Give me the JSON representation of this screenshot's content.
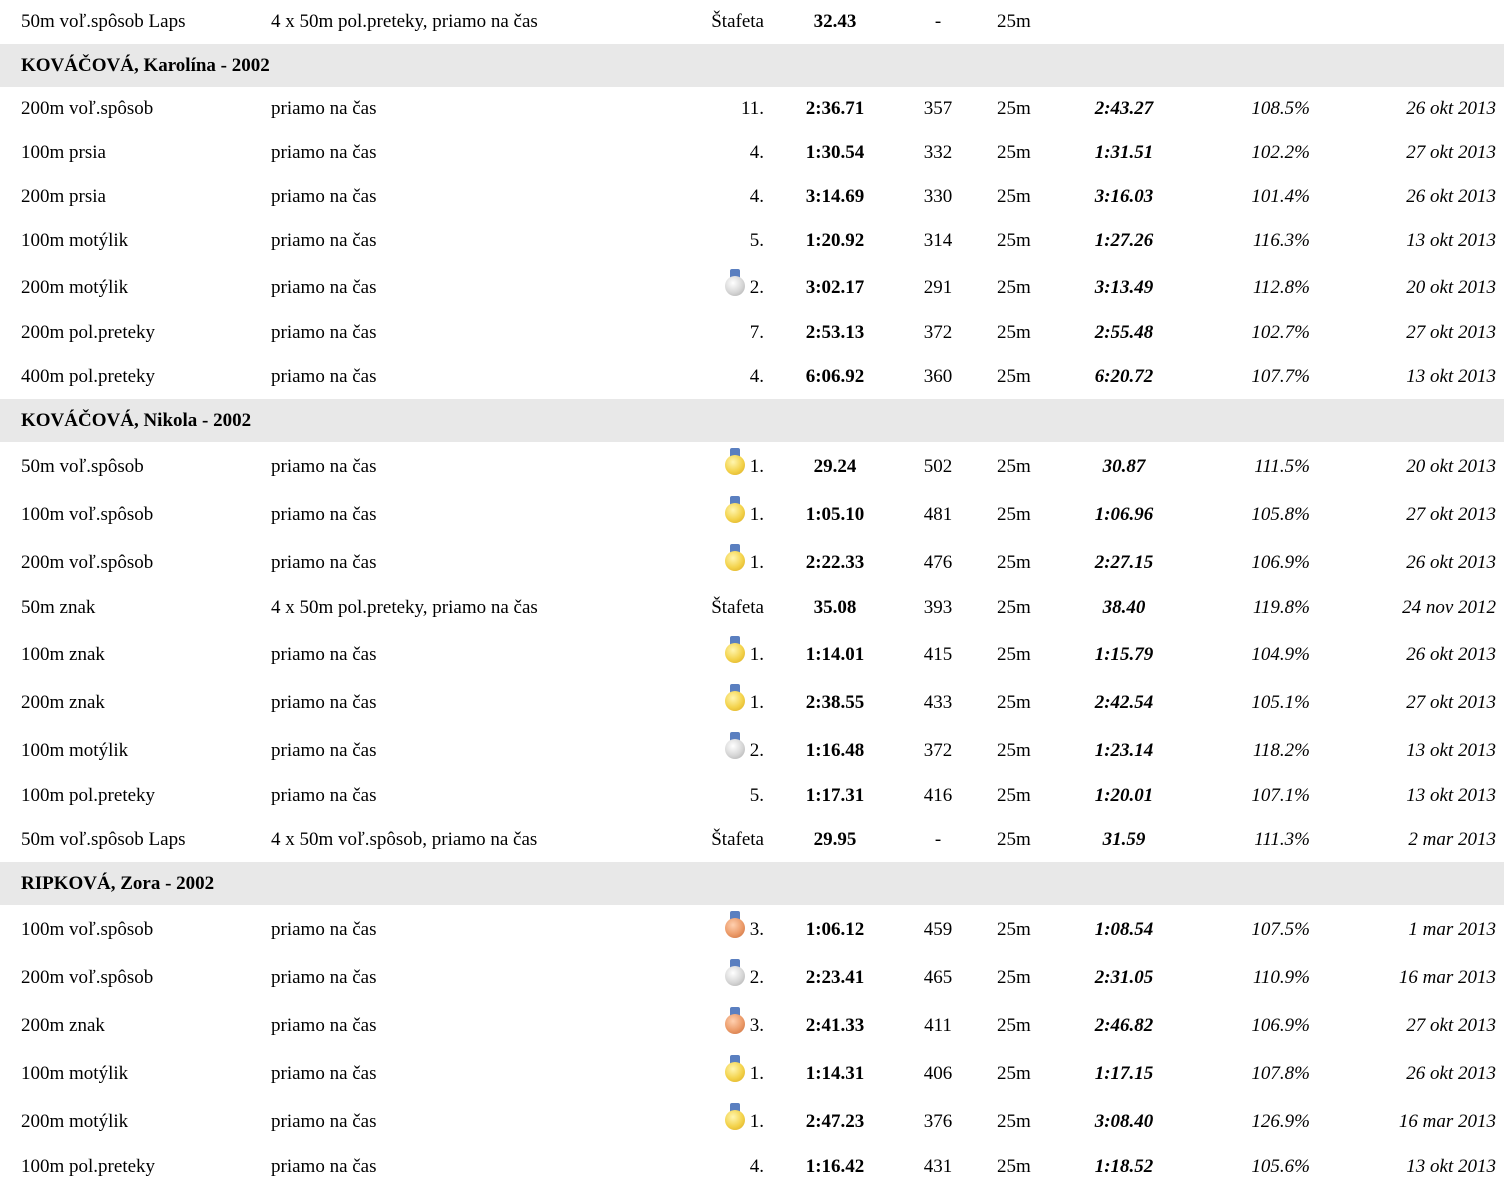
{
  "colors": {
    "header_background": "#e8e8e8",
    "gold": "#f3d24a",
    "silver": "#d6d6d6",
    "bronze": "#eb9a68",
    "ribbon": "#5a7fc0"
  },
  "rows": [
    {
      "type": "result",
      "event": "50m voľ.spôsob Laps",
      "detail": "4 x 50m pol.preteky, priamo na čas",
      "place": "Štafeta",
      "medal": "",
      "time": "32.43",
      "points": "-",
      "pool": "25m",
      "ref_time": "",
      "percent": "",
      "date": ""
    },
    {
      "type": "header",
      "text": "KOVÁČOVÁ, Karolína - 2002"
    },
    {
      "type": "result",
      "event": "200m voľ.spôsob",
      "detail": "priamo na čas",
      "place": "11.",
      "medal": "",
      "time": "2:36.71",
      "points": "357",
      "pool": "25m",
      "ref_time": "2:43.27",
      "percent": "108.5%",
      "date": "26 okt 2013"
    },
    {
      "type": "result",
      "event": "100m prsia",
      "detail": "priamo na čas",
      "place": "4.",
      "medal": "",
      "time": "1:30.54",
      "points": "332",
      "pool": "25m",
      "ref_time": "1:31.51",
      "percent": "102.2%",
      "date": "27 okt 2013"
    },
    {
      "type": "result",
      "event": "200m prsia",
      "detail": "priamo na čas",
      "place": "4.",
      "medal": "",
      "time": "3:14.69",
      "points": "330",
      "pool": "25m",
      "ref_time": "3:16.03",
      "percent": "101.4%",
      "date": "26 okt 2013"
    },
    {
      "type": "result",
      "event": "100m motýlik",
      "detail": "priamo na čas",
      "place": "5.",
      "medal": "",
      "time": "1:20.92",
      "points": "314",
      "pool": "25m",
      "ref_time": "1:27.26",
      "percent": "116.3%",
      "date": "13 okt 2013"
    },
    {
      "type": "result",
      "event": "200m motýlik",
      "detail": "priamo na čas",
      "place": "2.",
      "medal": "silver",
      "time": "3:02.17",
      "points": "291",
      "pool": "25m",
      "ref_time": "3:13.49",
      "percent": "112.8%",
      "date": "20 okt 2013"
    },
    {
      "type": "result",
      "event": "200m pol.preteky",
      "detail": "priamo na čas",
      "place": "7.",
      "medal": "",
      "time": "2:53.13",
      "points": "372",
      "pool": "25m",
      "ref_time": "2:55.48",
      "percent": "102.7%",
      "date": "27 okt 2013"
    },
    {
      "type": "result",
      "event": "400m pol.preteky",
      "detail": "priamo na čas",
      "place": "4.",
      "medal": "",
      "time": "6:06.92",
      "points": "360",
      "pool": "25m",
      "ref_time": "6:20.72",
      "percent": "107.7%",
      "date": "13 okt 2013"
    },
    {
      "type": "header",
      "text": "KOVÁČOVÁ, Nikola - 2002"
    },
    {
      "type": "result",
      "event": "50m voľ.spôsob",
      "detail": "priamo na čas",
      "place": "1.",
      "medal": "gold",
      "time": "29.24",
      "points": "502",
      "pool": "25m",
      "ref_time": "30.87",
      "percent": "111.5%",
      "date": "20 okt 2013"
    },
    {
      "type": "result",
      "event": "100m voľ.spôsob",
      "detail": "priamo na čas",
      "place": "1.",
      "medal": "gold",
      "time": "1:05.10",
      "points": "481",
      "pool": "25m",
      "ref_time": "1:06.96",
      "percent": "105.8%",
      "date": "27 okt 2013"
    },
    {
      "type": "result",
      "event": "200m voľ.spôsob",
      "detail": "priamo na čas",
      "place": "1.",
      "medal": "gold",
      "time": "2:22.33",
      "points": "476",
      "pool": "25m",
      "ref_time": "2:27.15",
      "percent": "106.9%",
      "date": "26 okt 2013"
    },
    {
      "type": "result",
      "event": "50m znak",
      "detail": "4 x 50m pol.preteky, priamo na čas",
      "place": "Štafeta",
      "medal": "",
      "time": "35.08",
      "points": "393",
      "pool": "25m",
      "ref_time": "38.40",
      "percent": "119.8%",
      "date": "24 nov 2012"
    },
    {
      "type": "result",
      "event": "100m znak",
      "detail": "priamo na čas",
      "place": "1.",
      "medal": "gold",
      "time": "1:14.01",
      "points": "415",
      "pool": "25m",
      "ref_time": "1:15.79",
      "percent": "104.9%",
      "date": "26 okt 2013"
    },
    {
      "type": "result",
      "event": "200m znak",
      "detail": "priamo na čas",
      "place": "1.",
      "medal": "gold",
      "time": "2:38.55",
      "points": "433",
      "pool": "25m",
      "ref_time": "2:42.54",
      "percent": "105.1%",
      "date": "27 okt 2013"
    },
    {
      "type": "result",
      "event": "100m motýlik",
      "detail": "priamo na čas",
      "place": "2.",
      "medal": "silver",
      "time": "1:16.48",
      "points": "372",
      "pool": "25m",
      "ref_time": "1:23.14",
      "percent": "118.2%",
      "date": "13 okt 2013"
    },
    {
      "type": "result",
      "event": "100m pol.preteky",
      "detail": "priamo na čas",
      "place": "5.",
      "medal": "",
      "time": "1:17.31",
      "points": "416",
      "pool": "25m",
      "ref_time": "1:20.01",
      "percent": "107.1%",
      "date": "13 okt 2013"
    },
    {
      "type": "result",
      "event": "50m voľ.spôsob Laps",
      "detail": "4 x 50m voľ.spôsob, priamo na čas",
      "place": "Štafeta",
      "medal": "",
      "time": "29.95",
      "points": "-",
      "pool": "25m",
      "ref_time": "31.59",
      "percent": "111.3%",
      "date": "2 mar 2013"
    },
    {
      "type": "header",
      "text": "RIPKOVÁ, Zora - 2002"
    },
    {
      "type": "result",
      "event": "100m voľ.spôsob",
      "detail": "priamo na čas",
      "place": "3.",
      "medal": "bronze",
      "time": "1:06.12",
      "points": "459",
      "pool": "25m",
      "ref_time": "1:08.54",
      "percent": "107.5%",
      "date": "1 mar 2013"
    },
    {
      "type": "result",
      "event": "200m voľ.spôsob",
      "detail": "priamo na čas",
      "place": "2.",
      "medal": "silver",
      "time": "2:23.41",
      "points": "465",
      "pool": "25m",
      "ref_time": "2:31.05",
      "percent": "110.9%",
      "date": "16 mar 2013"
    },
    {
      "type": "result",
      "event": "200m znak",
      "detail": "priamo na čas",
      "place": "3.",
      "medal": "bronze",
      "time": "2:41.33",
      "points": "411",
      "pool": "25m",
      "ref_time": "2:46.82",
      "percent": "106.9%",
      "date": "27 okt 2013"
    },
    {
      "type": "result",
      "event": "100m motýlik",
      "detail": "priamo na čas",
      "place": "1.",
      "medal": "gold",
      "time": "1:14.31",
      "points": "406",
      "pool": "25m",
      "ref_time": "1:17.15",
      "percent": "107.8%",
      "date": "26 okt 2013"
    },
    {
      "type": "result",
      "event": "200m motýlik",
      "detail": "priamo na čas",
      "place": "1.",
      "medal": "gold",
      "time": "2:47.23",
      "points": "376",
      "pool": "25m",
      "ref_time": "3:08.40",
      "percent": "126.9%",
      "date": "16 mar 2013"
    },
    {
      "type": "result",
      "event": "100m pol.preteky",
      "detail": "priamo na čas",
      "place": "4.",
      "medal": "",
      "time": "1:16.42",
      "points": "431",
      "pool": "25m",
      "ref_time": "1:18.52",
      "percent": "105.6%",
      "date": "13 okt 2013"
    }
  ]
}
